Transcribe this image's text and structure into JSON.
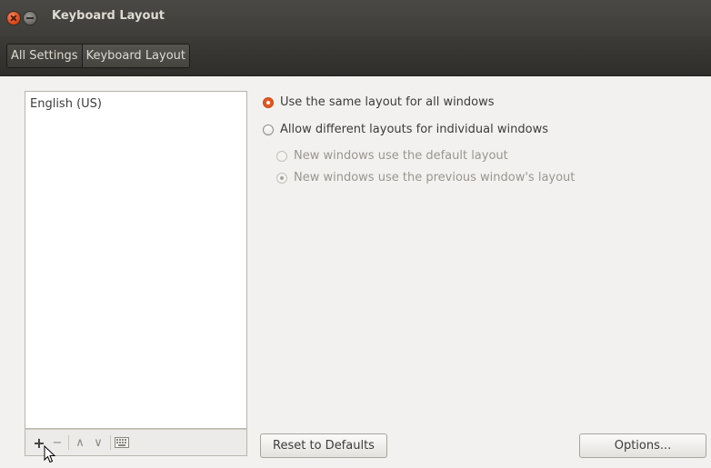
{
  "window": {
    "title": "Keyboard Layout"
  },
  "breadcrumb": {
    "items": [
      "All Settings",
      "Keyboard Layout"
    ]
  },
  "layouts": {
    "items": [
      "English (US)"
    ]
  },
  "toolbar": {
    "add": "+",
    "remove": "−",
    "up": "∧",
    "down": "∨",
    "keyboard_icon": "keyboard-icon"
  },
  "options": {
    "same_layout": "Use the same layout for all windows",
    "different_layouts": "Allow different layouts for individual windows",
    "new_default": "New windows use the default layout",
    "new_previous": "New windows use the previous window's layout"
  },
  "buttons": {
    "reset": "Reset to Defaults",
    "options": "Options..."
  },
  "colors": {
    "accent": "#e95420",
    "titlebar": "#3e3d39",
    "background": "#f2f1f0"
  }
}
